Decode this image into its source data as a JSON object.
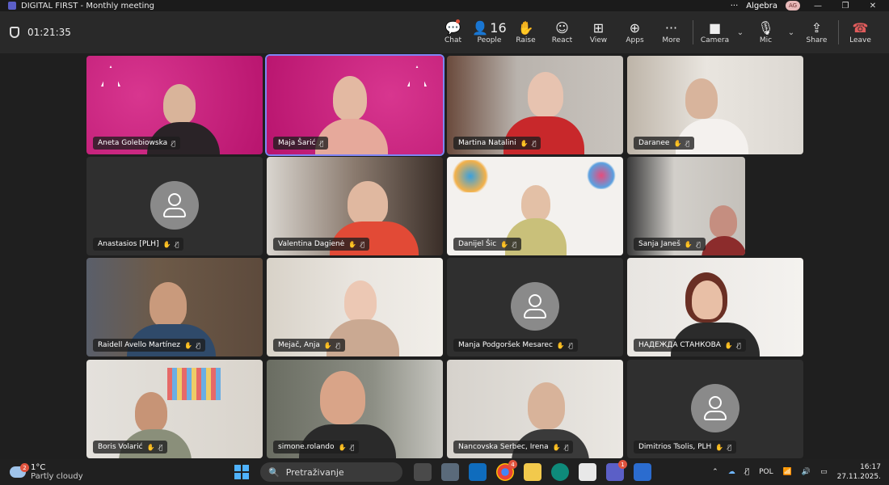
{
  "window": {
    "title": "DIGITAL FIRST - Monthly meeting",
    "account": "Algebra",
    "initials": "AG"
  },
  "meeting": {
    "elapsed": "01:21:35"
  },
  "toolbar": {
    "chat": "Chat",
    "people": "People",
    "people_count": "16",
    "raise": "Raise",
    "react": "React",
    "view": "View",
    "apps": "Apps",
    "more": "More",
    "camera": "Camera",
    "mic": "Mic",
    "share": "Share",
    "leave": "Leave"
  },
  "participants": [
    {
      "name": "Aneta Golebiowska"
    },
    {
      "name": "Maja Šarić"
    },
    {
      "name": "Martina Natalini"
    },
    {
      "name": "Daranee"
    },
    {
      "name": "Anastasios [PLH]"
    },
    {
      "name": "Valentina Dagienė"
    },
    {
      "name": "Danijel Šic"
    },
    {
      "name": "Sanja Janeš"
    },
    {
      "name": "Raidell Avello Martínez"
    },
    {
      "name": "Mejač, Anja"
    },
    {
      "name": "Manja Podgoršek Mesarec"
    },
    {
      "name": "НАДЕЖДА СТАНКОВА"
    },
    {
      "name": "Boris Volarić"
    },
    {
      "name": "simone.rolando"
    },
    {
      "name": "Nancovska Serbec, Irena"
    },
    {
      "name": "Dimitrios Tsolis, PLH"
    }
  ],
  "taskbar": {
    "weather_temp": "1°C",
    "weather_desc": "Partly cloudy",
    "weather_badge": "2",
    "search_placeholder": "Pretraživanje",
    "lang": "POL",
    "time": "16:17",
    "date": "27.11.2025.",
    "chrome_badge": "4",
    "teams_badge": "1"
  },
  "colors": {
    "accent": "#7f85f5",
    "brand_pink": "#c81f7c",
    "leave_red": "#e05b5b"
  }
}
